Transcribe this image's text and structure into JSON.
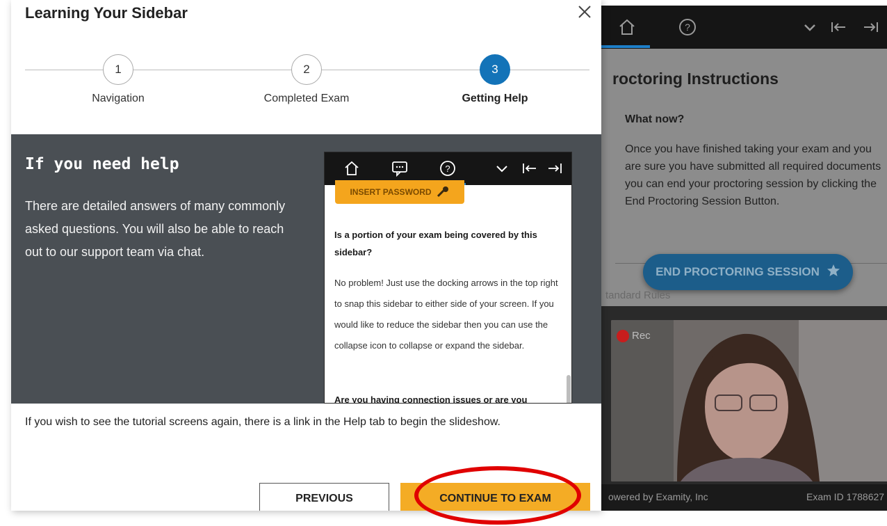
{
  "modal": {
    "title": "Learning Your Sidebar",
    "steps": [
      {
        "number": "1",
        "label": "Navigation",
        "active": false
      },
      {
        "number": "2",
        "label": "Completed Exam",
        "active": false
      },
      {
        "number": "3",
        "label": "Getting Help",
        "active": true
      }
    ],
    "help_heading": "If you need help",
    "help_text": "There are detailed answers of many commonly asked questions. You will also be able to reach out to our support team via chat.",
    "tutorial_note": "If you wish to see the tutorial screens again, there is a link in the Help tab to begin the slideshow.",
    "previous_label": "PREVIOUS",
    "continue_label": "CONTINUE TO EXAM"
  },
  "preview": {
    "insert_password_label": "INSERT PASSWORD",
    "question1": "Is a portion of your exam being covered by this sidebar?",
    "answer1": "No problem! Just use the docking arrows in the top right to snap this sidebar to either side of your screen. If you would like to reduce the sidebar then you can use the collapse icon to collapse or expand the sidebar.",
    "question2": "Are you having connection issues or are you"
  },
  "sidebar": {
    "title": "roctoring Instructions",
    "what_now": "What now?",
    "instructions": "Once you have finished taking your exam and you are sure you have submitted all required documents you can end your proctoring session by clicking the End Proctoring Session Button.",
    "end_button_label": "END PROCTORING SESSION",
    "standard_rules": "tandard Rules",
    "rec_label": "Rec",
    "powered_by": "owered by Examity, Inc",
    "exam_id": "Exam ID 1788627"
  },
  "colors": {
    "accent_blue": "#1373b8",
    "continue_orange": "#f4ac25",
    "highlight_red": "#e00000",
    "panel_gray": "#4a4f54"
  },
  "icons": [
    "close-icon",
    "home-icon",
    "chat-icon",
    "help-icon",
    "chevron-down-icon",
    "dock-left-icon",
    "dock-right-icon",
    "key-icon",
    "star-icon"
  ]
}
